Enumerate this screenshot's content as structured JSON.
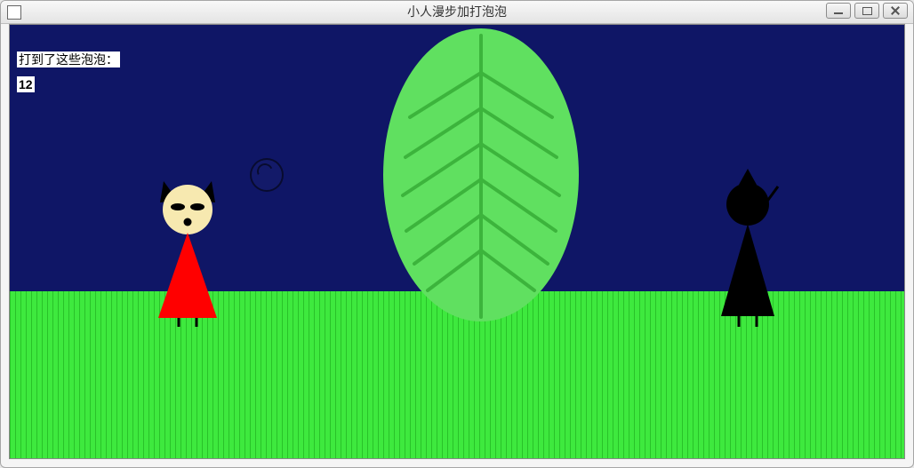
{
  "window": {
    "title": "小人漫步加打泡泡"
  },
  "hud": {
    "score_label": "打到了这些泡泡：",
    "score_value": "12"
  },
  "colors": {
    "sky": "#0f1666",
    "grass": "#3ee93e",
    "grass_stripe": "#29c229",
    "leaf": "#60e060",
    "leaf_vein": "#3cb43c",
    "girl_face": "#f7e9b0",
    "girl_dress": "#ff0000",
    "shadow": "#000000",
    "moon": "#ffffff"
  },
  "icons": {
    "moon": "moon-icon",
    "leaf": "leaf-icon",
    "bubble": "bubble-icon"
  }
}
